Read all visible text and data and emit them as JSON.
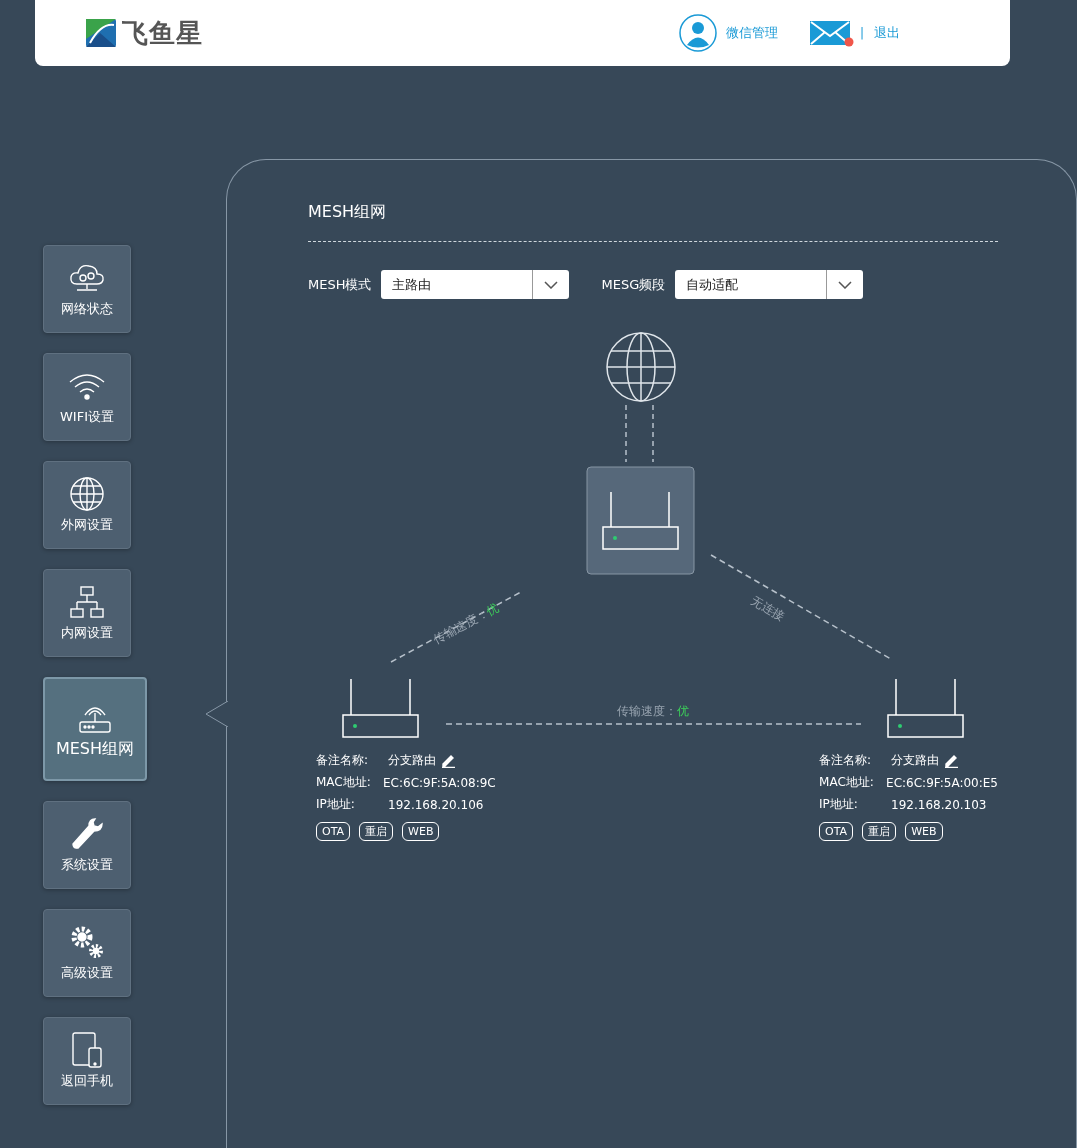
{
  "header": {
    "logo_text": "飞鱼星",
    "account_link": "微信管理",
    "mail_unread": true,
    "separator": "|",
    "logout": "退出"
  },
  "sidebar": {
    "items": [
      {
        "label": "网络状态",
        "kind": "cloud",
        "selected": false
      },
      {
        "label": "WIFI设置",
        "kind": "wifi",
        "selected": false
      },
      {
        "label": "外网设置",
        "kind": "globe",
        "selected": false
      },
      {
        "label": "内网设置",
        "kind": "lan",
        "selected": false
      },
      {
        "label": "MESH组网",
        "kind": "mesh",
        "selected": true
      },
      {
        "label": "系统设置",
        "kind": "wrench",
        "selected": false
      },
      {
        "label": "高级设置",
        "kind": "gears",
        "selected": false
      },
      {
        "label": "返回手机",
        "kind": "phone",
        "selected": false
      }
    ]
  },
  "panel": {
    "title": "MESH组网",
    "fields": [
      {
        "label": "MESH模式",
        "value": "主路由"
      },
      {
        "label": "MESG频段",
        "value": "自动适配"
      }
    ],
    "links": [
      {
        "kind": "speed",
        "label": "传输速度：",
        "quality": "优"
      },
      {
        "kind": "none",
        "label": "无连接"
      },
      {
        "kind": "speed",
        "label": "传输速度：",
        "quality": "优"
      }
    ],
    "nodes": [
      {
        "name_label": "备注名称:",
        "name": "分支路由",
        "mac_label": "MAC地址:",
        "mac": "EC:6C:9F:5A:08:9C",
        "ip_label": "IP地址:",
        "ip": "192.168.20.106",
        "actions": [
          "OTA",
          "重启",
          "WEB"
        ]
      },
      {
        "name_label": "备注名称:",
        "name": "分支路由",
        "mac_label": "MAC地址:",
        "mac": "EC:6C:9F:5A:00:E5",
        "ip_label": "IP地址:",
        "ip": "192.168.20.103",
        "actions": [
          "OTA",
          "重启",
          "WEB"
        ]
      }
    ]
  }
}
